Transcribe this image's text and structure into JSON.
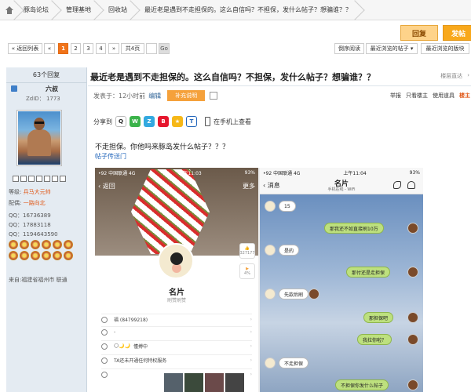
{
  "breadcrumb": [
    "豚岛论坛",
    "管理基地",
    "回收站",
    "最近老是遇到不走担保的。这么自信吗？不担保，发什么帖子？想骗谁？？"
  ],
  "actions": {
    "reply": "回复",
    "post": "发帖"
  },
  "pager": {
    "back": "« 返回列表",
    "prev": "«",
    "pages": [
      "1",
      "2",
      "3",
      "4"
    ],
    "next": "»",
    "total": "共4页",
    "go": "Go",
    "right_buttons": [
      "倒序阅读",
      "最近浏览的帖子 ▾",
      "最近浏览的版块"
    ]
  },
  "sidebar": {
    "reply_count": "63个回复",
    "username": "六叔",
    "uid_label": "ZdID：",
    "uid_value": "1773",
    "level_label": "等级:",
    "level_value": "兵马大元帅",
    "config_label": "配偶:",
    "config_value": "一路向北",
    "qq": [
      "QQ：16736389",
      "QQ：17883118",
      "QQ：1194643590"
    ],
    "location": "来自:福建省福州市 联通"
  },
  "post": {
    "title": "最近老是遇到不走担保的。这么自信吗？不担保，发什么帖子？想骗谁？？",
    "title_tools": [
      "楼层直达",
      "›"
    ],
    "time_label": "发表于：12小时前",
    "edit": "编辑",
    "supplement": "补充说明",
    "right_tools": [
      "举报",
      "只看楼主",
      "使用道具"
    ],
    "floor": "楼主",
    "share_label": "分享到",
    "mobile_view": "在手机上查看",
    "body": "不走担保。你他吗来豚岛发什么帖子？？？",
    "link": "帖子传送门"
  },
  "shot1": {
    "carrier": "•92 中国联通  4G",
    "time": "上午11:03",
    "battery": "93%",
    "back": "返回",
    "more": "更多",
    "name": "名片",
    "sub": "刷赞刷赞",
    "qq_num": "福 (84799218)",
    "gender": "-",
    "star_row": "懂搏中",
    "privilege": "TA还未开通任何特权服务",
    "like_count": "327177",
    "like_label": "4%"
  },
  "shot2": {
    "carrier": "•92 中国联通  4G",
    "time": "上午11:04",
    "battery": "93%",
    "back": "消息",
    "title": "名片",
    "subtitle": "手机在线 - WiFi",
    "messages": [
      {
        "from": "them",
        "text": "15"
      },
      {
        "from": "me",
        "text": "那我还不如直接刷10万"
      },
      {
        "from": "them",
        "text": "是的"
      },
      {
        "from": "me",
        "text": "那付还是走担保"
      },
      {
        "from": "them",
        "text": "先款后刷"
      },
      {
        "from": "me",
        "text": "那担保吧"
      },
      {
        "from": "me",
        "text": "我拉你啦？"
      },
      {
        "from": "them",
        "text": "不走担保"
      },
      {
        "from": "me",
        "text": "不担保你发什么帖子"
      }
    ]
  },
  "colors": {
    "accent": "#f0731a",
    "sidebar_bg": "#e4ebf2",
    "link": "#2266bb"
  }
}
